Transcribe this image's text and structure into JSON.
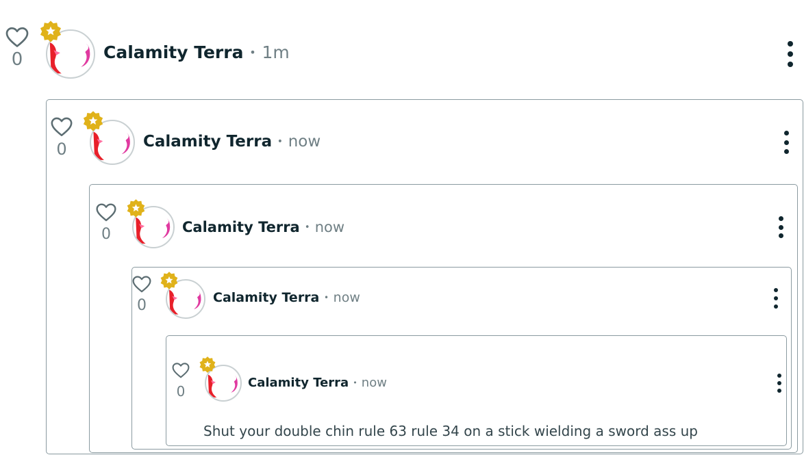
{
  "comments": [
    {
      "author": "Calamity Terra",
      "dot": "•",
      "time": "1m",
      "likes": "0"
    },
    {
      "author": "Calamity Terra",
      "dot": "•",
      "time": "now",
      "likes": "0"
    },
    {
      "author": "Calamity Terra",
      "dot": "•",
      "time": "now",
      "likes": "0"
    },
    {
      "author": "Calamity Terra",
      "dot": "•",
      "time": "now",
      "likes": "0"
    },
    {
      "author": "Calamity Terra",
      "dot": "•",
      "time": "now",
      "likes": "0",
      "body": "Shut your double chin rule 63 rule 34 on a stick wielding a sword ass up"
    }
  ],
  "colors": {
    "badge": "#e0b21a",
    "text": "#10262e",
    "muted": "#6f7f84",
    "border": "#8a9aa0",
    "avatar_art": "#e8202a"
  },
  "icons": {
    "like": "heart-outline-icon",
    "badge": "star-badge-icon",
    "menu": "kebab-menu-icon"
  }
}
